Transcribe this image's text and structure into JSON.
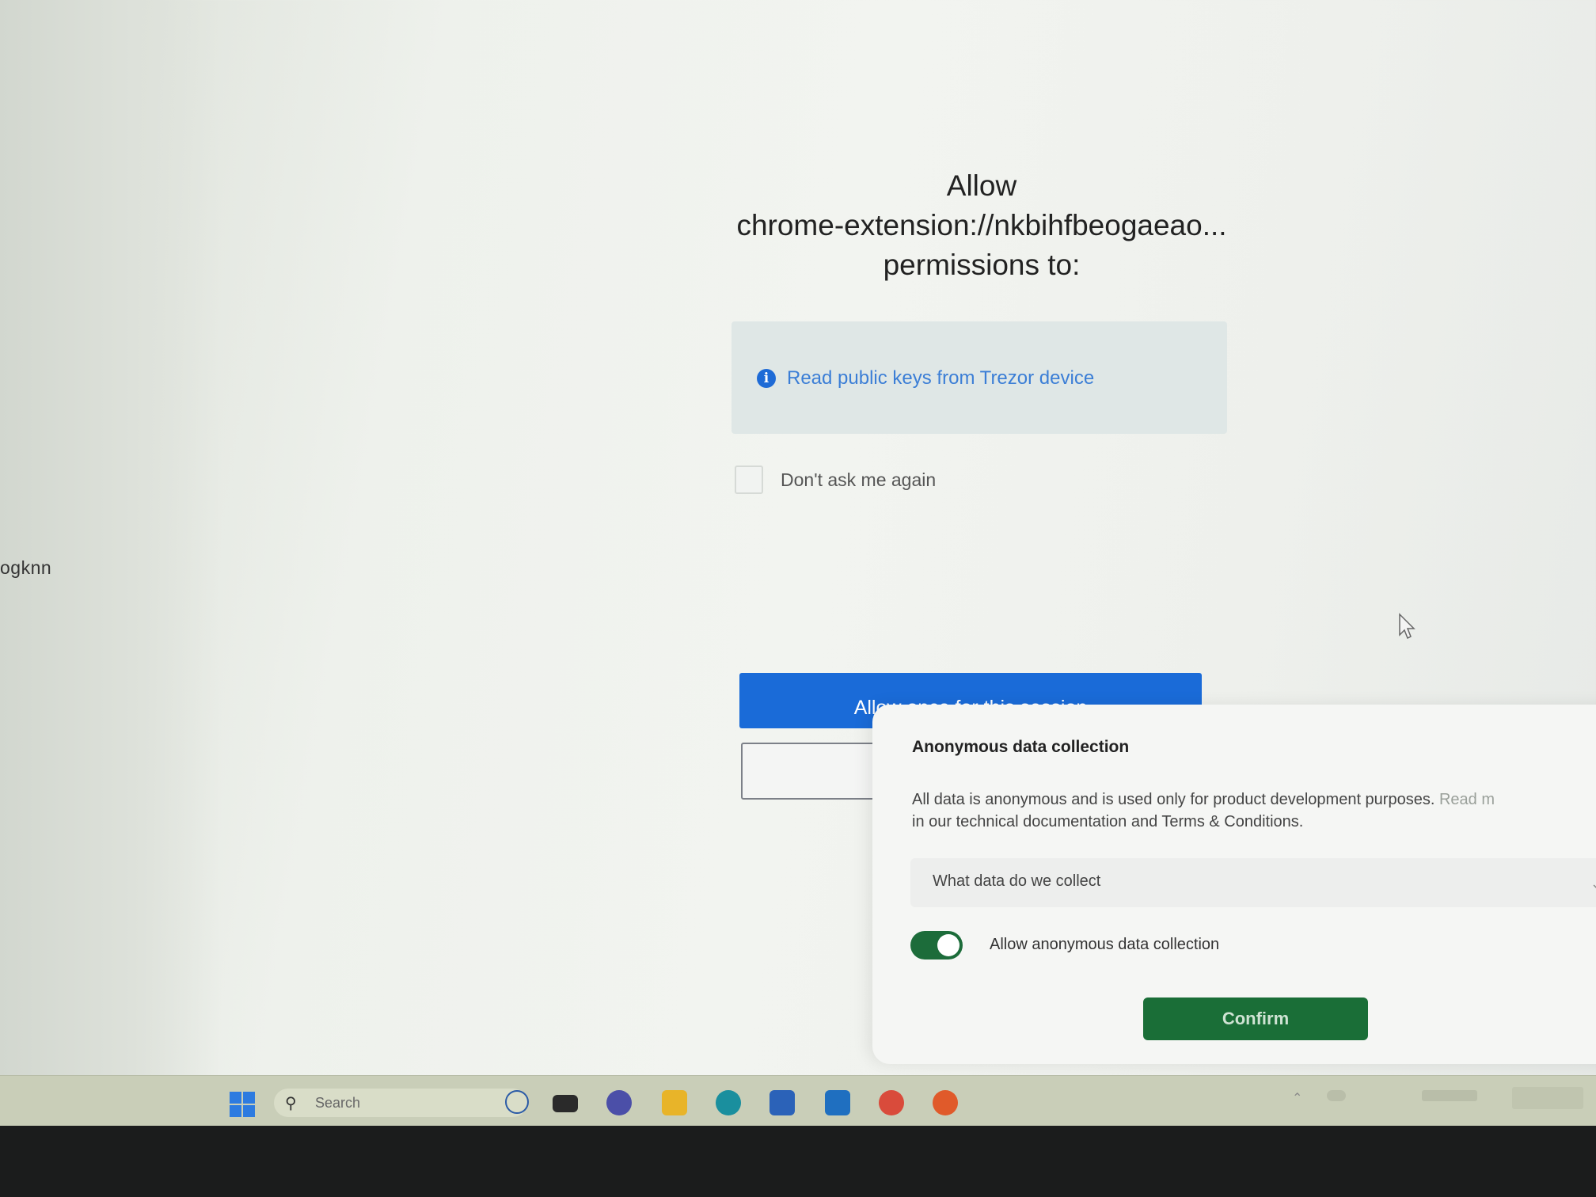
{
  "side": {
    "cut_text": "ogknn"
  },
  "dialog": {
    "title_line1": "Allow",
    "title_line2": "chrome-extension://nkbihfbeogaeao...",
    "title_line3": "permissions to:",
    "permission": "Read public keys from Trezor device",
    "dont_ask_label": "Don't ask me again",
    "allow_button": "Allow once for this session"
  },
  "modal": {
    "title": "Anonymous data collection",
    "desc_line1": "All data is anonymous and is used only for product development purposes.",
    "desc_line1_faded": " Read m",
    "desc_line2": "in our technical documentation and Terms & Conditions.",
    "collect_label": "What data do we collect",
    "toggle_label": "Allow anonymous data collection",
    "toggle_on": true,
    "confirm_button": "Confirm"
  },
  "taskbar": {
    "search_placeholder": "Search",
    "icons": [
      "windows-start-icon",
      "search-icon",
      "bing-icon",
      "terminal-icon",
      "teams-icon",
      "file-explorer-icon",
      "edge-icon",
      "store-icon",
      "l-app-icon",
      "chrome-icon",
      "firefox-icon"
    ]
  },
  "colors": {
    "primary_blue": "#1a6bd8",
    "confirm_green": "#1a6e37",
    "info_blue": "#3b7ed6"
  }
}
